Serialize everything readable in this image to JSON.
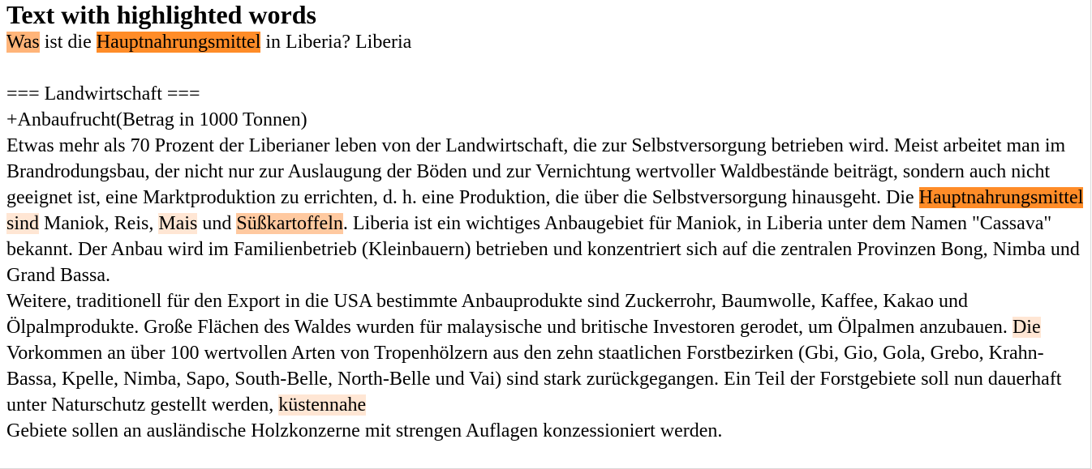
{
  "title": "Text with highlighted words",
  "segments": [
    {
      "t": "Was",
      "h": 2
    },
    {
      "t": " ist die "
    },
    {
      "t": "Hauptnahrungsmittel",
      "h": 1
    },
    {
      "t": " in Liberia? Liberia\n\n=== Landwirtschaft ===\n+Anbaufrucht(Betrag in 1000 Tonnen)\nEtwas mehr als 70 Prozent der Liberianer leben von der Landwirtschaft, die zur Selbstversorgung betrieben wird. Meist arbeitet man im Brandrodungsbau, der nicht nur zur Auslaugung der Böden und zur Vernichtung wertvoller Waldbestände beiträgt, sondern auch nicht geeignet ist, eine Marktproduktion zu errichten, d. h. eine Produktion, die über die Selbstversorgung hinausgeht. Die "
    },
    {
      "t": "Hauptnahrungsmittel",
      "h": 1
    },
    {
      "t": " "
    },
    {
      "t": "sind",
      "h": 4
    },
    {
      "t": " Maniok, Reis, "
    },
    {
      "t": "Mais",
      "h": 4
    },
    {
      "t": " und "
    },
    {
      "t": "Süßkartoffeln",
      "h": 3
    },
    {
      "t": ". Liberia ist ein wichtiges Anbaugebiet für Maniok, in Liberia unter dem Namen \"Cassava\" bekannt. Der Anbau wird im Familienbetrieb (Kleinbauern) betrieben und konzentriert sich auf die zentralen Provinzen Bong, Nimba und Grand Bassa.\nWeitere, traditionell für den Export in die USA bestimmte Anbauprodukte sind Zuckerrohr, Baumwolle, Kaffee, Kakao und Ölpalmprodukte. Große Flächen des Waldes wurden für malaysische und britische Investoren gerodet, um Ölpalmen anzubauen. "
    },
    {
      "t": "Die",
      "h": 4
    },
    {
      "t": " Vorkommen an über 100 wertvollen Arten von Tropenhölzern aus den zehn staatlichen Forstbezirken (Gbi, Gio, Gola, Grebo, Krahn-Bassa, Kpelle, Nimba, Sapo, South-Belle, North-Belle und Vai) sind stark zurückgegangen. Ein Teil der Forstgebiete soll nun dauerhaft unter Naturschutz gestellt werden, "
    },
    {
      "t": "küstennahe",
      "h": 4
    },
    {
      "t": "\nGebiete sollen an ausländische Holzkonzerne mit strengen Auflagen konzessioniert werden."
    }
  ],
  "colors": {
    "highlight_strong": "#ff8c28",
    "highlight_medium": "#ffb479",
    "highlight_light": "#ffc9a0",
    "highlight_faint": "#ffe6d4"
  }
}
